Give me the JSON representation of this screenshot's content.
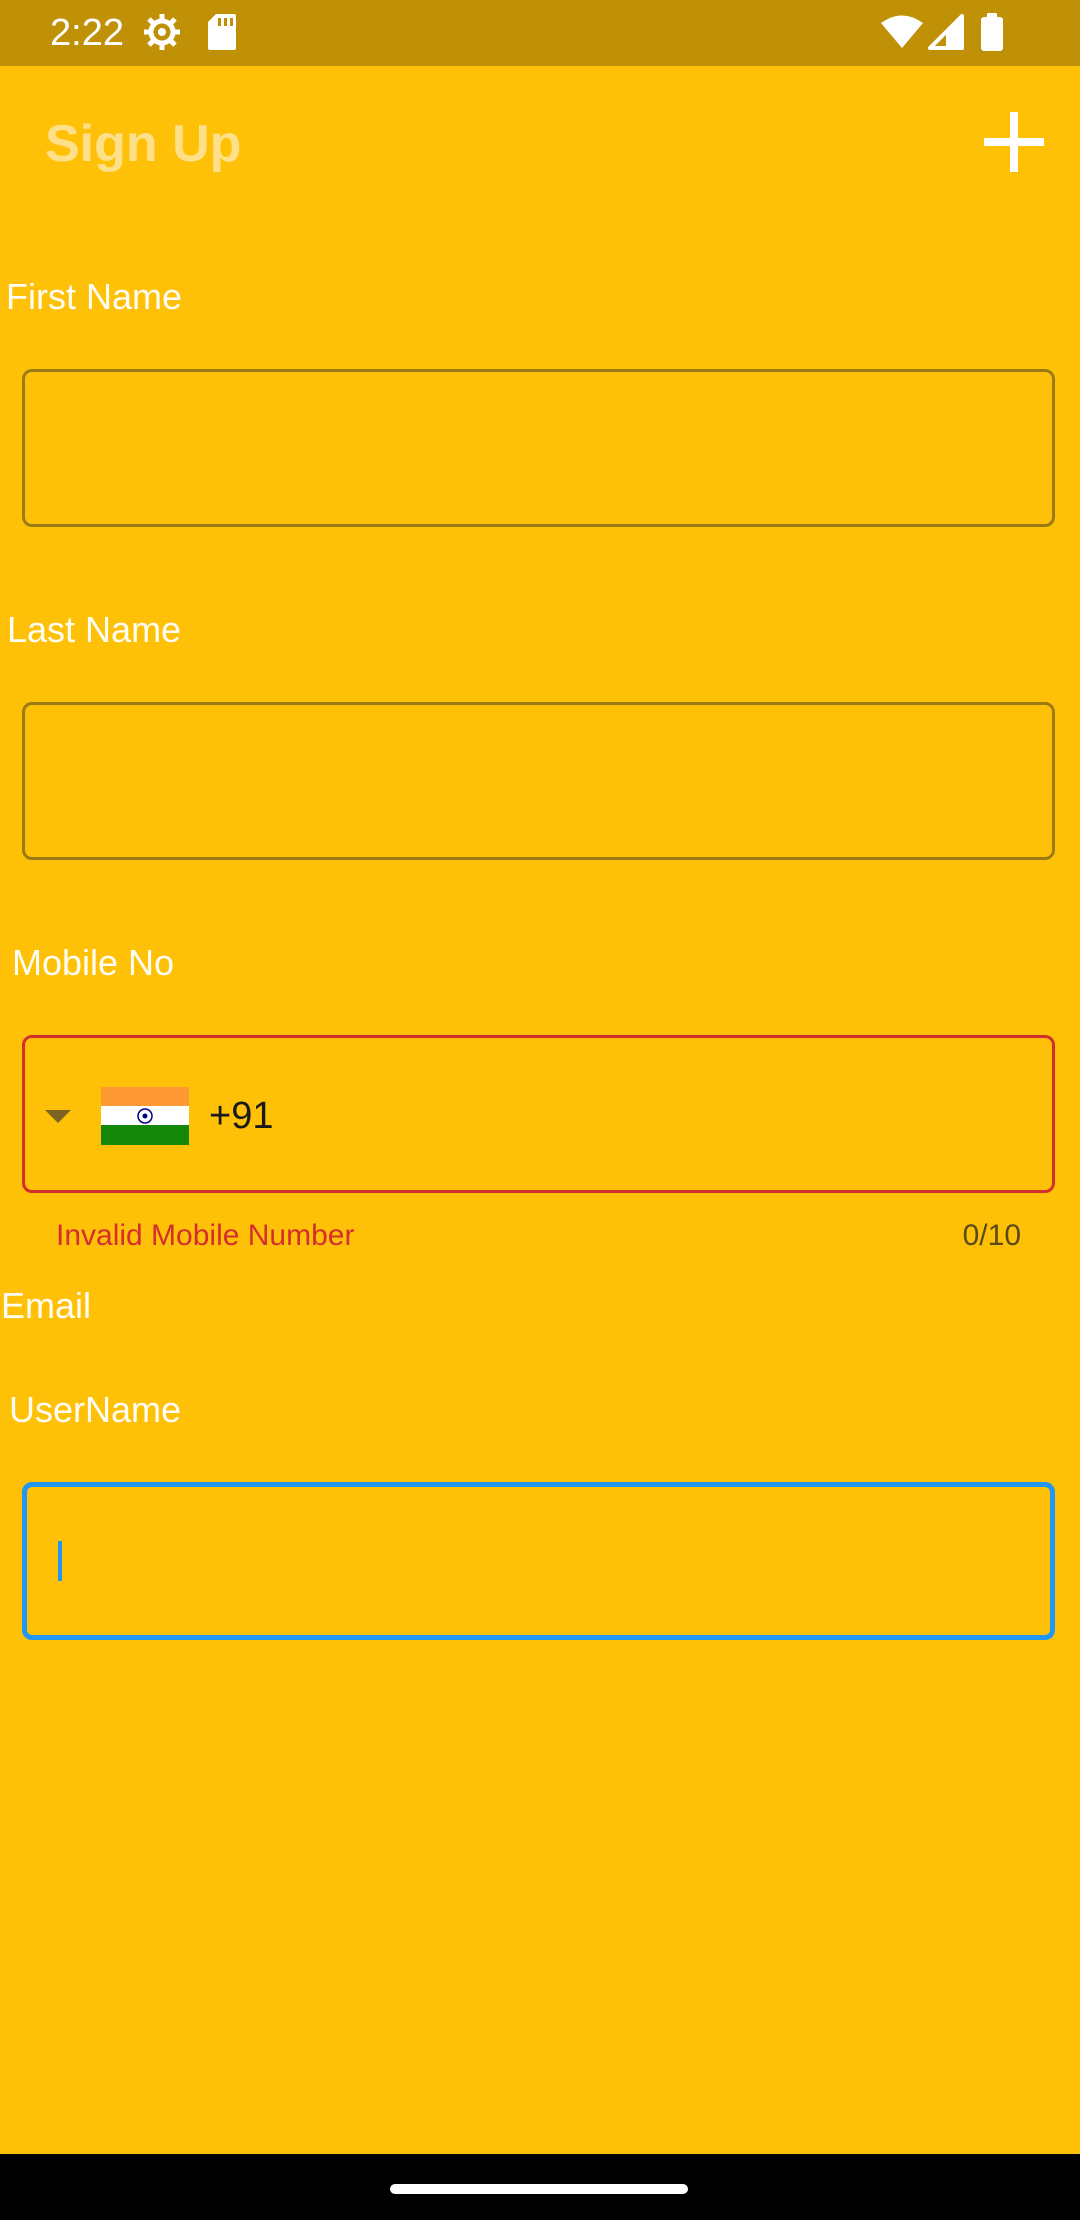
{
  "status_bar": {
    "time": "2:22",
    "icons": [
      "settings-gear-icon",
      "sd-card-icon",
      "wifi-icon",
      "cell-signal-icon",
      "battery-icon"
    ]
  },
  "app_bar": {
    "title": "Sign Up",
    "action_icon": "add-icon"
  },
  "form": {
    "first_name": {
      "label": "First Name",
      "value": ""
    },
    "last_name": {
      "label": "Last Name",
      "value": ""
    },
    "mobile": {
      "label": "Mobile No",
      "country_flag": "india-flag-icon",
      "dial_code": "+91",
      "value": "",
      "error": "Invalid Mobile Number",
      "counter": "0/10"
    },
    "email": {
      "label": "Email"
    },
    "username": {
      "label": "UserName",
      "value": ""
    }
  },
  "colors": {
    "background": "#FFC107",
    "status_bar": "#C09006",
    "error": "#D32F2F",
    "focus": "#2196F3"
  }
}
